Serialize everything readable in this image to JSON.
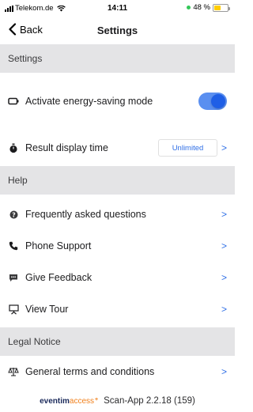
{
  "status_bar": {
    "carrier": "Telekom.de",
    "time": "14:11",
    "battery_percent": "48 %",
    "battery_level": 0.48,
    "battery_color": "#ffcc00"
  },
  "nav": {
    "back_label": "Back",
    "title": "Settings"
  },
  "sections": {
    "settings": {
      "header": "Settings"
    },
    "help": {
      "header": "Help"
    },
    "legal": {
      "header": "Legal Notice"
    }
  },
  "rows": {
    "energy_saving": {
      "label": "Activate energy-saving mode",
      "icon": "battery-icon",
      "toggle_on": true
    },
    "result_display": {
      "label": "Result display time",
      "icon": "stopwatch-icon",
      "value": "Unlimited",
      "chevron": ">"
    },
    "faq": {
      "label": "Frequently asked questions",
      "icon": "question-icon",
      "chevron": ">"
    },
    "phone_support": {
      "label": "Phone Support",
      "icon": "phone-icon",
      "chevron": ">"
    },
    "feedback": {
      "label": "Give Feedback",
      "icon": "chat-icon",
      "chevron": ">"
    },
    "tour": {
      "label": "View Tour",
      "icon": "presentation-icon",
      "chevron": ">"
    },
    "terms": {
      "label": "General terms and conditions",
      "icon": "legal-icon",
      "chevron": ">"
    }
  },
  "footer": {
    "brand_main": "eventim",
    "brand_accent": "access",
    "brand_plus": "+",
    "app_version": "Scan-App 2.2.18 (159)"
  },
  "colors": {
    "accent": "#2f6fe6",
    "section_bg": "#e4e4e6",
    "toggle_on": "#5a8ff0"
  }
}
